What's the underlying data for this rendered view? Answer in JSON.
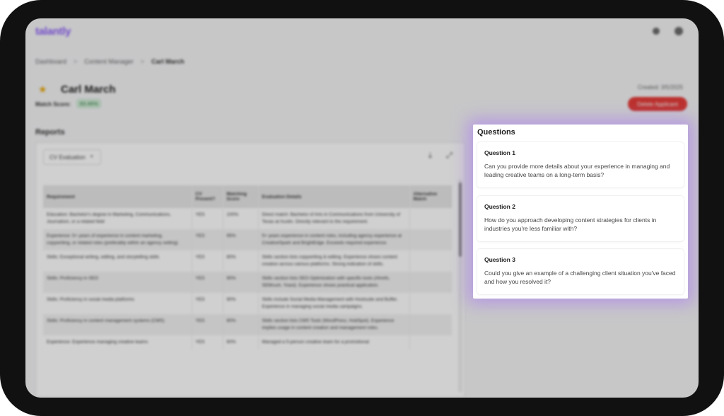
{
  "app": {
    "logo": "talantly"
  },
  "breadcrumb": {
    "items": [
      "Dashboard",
      "Content Manager",
      "Carl March"
    ],
    "separator": ">"
  },
  "applicant": {
    "name": "Carl March",
    "match_label": "Match Score:",
    "match_score": "83.46%",
    "created": "Created: 3/5/2025",
    "delete_label": "Delete Applicant"
  },
  "reports": {
    "title": "Reports",
    "selector": "CV Evaluation",
    "columns": [
      "Requirement",
      "CV Present?",
      "Matching Score",
      "Evaluation Details",
      "Alternative Match"
    ],
    "rows": [
      [
        "Education: Bachelor's degree in Marketing, Communications, Journalism, or a related field",
        "YES",
        "100%",
        "Direct match: Bachelor of Arts in Communications from University of Texas at Austin. Directly relevant to the requirement.",
        ""
      ],
      [
        "Experience: 5+ years of experience in content marketing, copywriting, or related roles (preferably within an agency setting)",
        "YES",
        "95%",
        "5+ years experience in content roles, including agency experience at CreativeSpark and BrightEdge. Exceeds required experience.",
        ""
      ],
      [
        "Skills: Exceptional writing, editing, and storytelling skills",
        "YES",
        "80%",
        "Skills section lists copywriting & editing. Experience shows content creation across various platforms. Strong indication of skills.",
        ""
      ],
      [
        "Skills: Proficiency in SEO",
        "YES",
        "90%",
        "Skills section lists SEO Optimization with specific tools (Ahrefs, SEMrush, Yoast). Experience shows practical application.",
        ""
      ],
      [
        "Skills: Proficiency in social media platforms",
        "YES",
        "90%",
        "Skills include Social Media Management with Hootsuite and Buffer. Experience in managing social media campaigns.",
        ""
      ],
      [
        "Skills: Proficiency in content management systems (CMS)",
        "YES",
        "80%",
        "Skills section lists CMS Tools (WordPress, HubSpot). Experience implies usage in content creation and management roles.",
        ""
      ],
      [
        "Experience: Experience managing creative teams",
        "YES",
        "60%",
        "Managed a 5-person creative team for a promotional",
        ""
      ]
    ]
  },
  "questions": {
    "title": "Questions",
    "items": [
      {
        "label": "Question 1",
        "text": "Can you provide more details about your experience in managing and leading creative teams on a long-term basis?"
      },
      {
        "label": "Question 2",
        "text": "How do you approach developing content strategies for clients in industries you're less familiar with?"
      },
      {
        "label": "Question 3",
        "text": "Could you give an example of a challenging client situation you've faced and how you resolved it?"
      }
    ]
  }
}
